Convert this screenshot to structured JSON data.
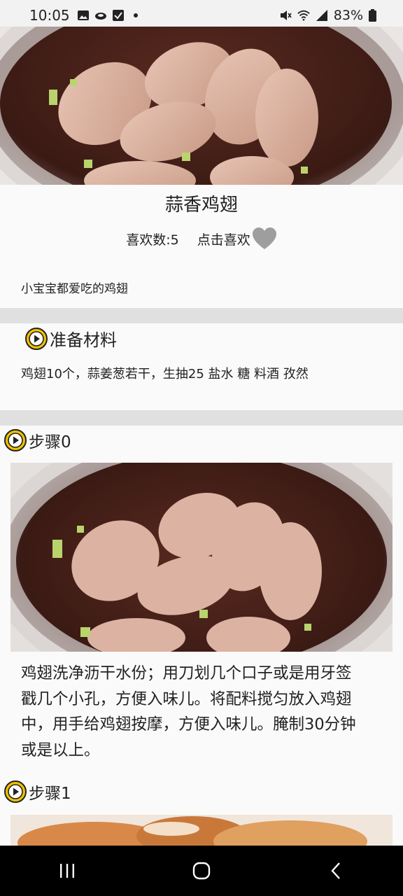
{
  "status_bar": {
    "time": "10:05",
    "battery": "83%",
    "icons": [
      "gallery-icon",
      "cloud-icon",
      "checkbox-icon",
      "dot-icon",
      "mute-icon",
      "wifi-icon",
      "signal-icon",
      "battery-icon"
    ]
  },
  "recipe": {
    "title": "蒜香鸡翅",
    "likes_label": "喜欢数:5",
    "like_action": "点击喜欢",
    "description": "小宝宝都爱吃的鸡翅"
  },
  "materials": {
    "heading": "准备材料",
    "text": "鸡翅10个，蒜姜葱若干，生抽25 盐水  糖  料酒 孜然"
  },
  "steps": [
    {
      "label": "步骤0",
      "text_lines": [
        "鸡翅洗净沥干水份；用刀划几个口子或是用牙签",
        "戳几个小孔，方便入味儿。将配料搅匀放入鸡翅",
        "中，用手给鸡翅按摩，方便入味儿。腌制30分钟",
        "或是以上。"
      ]
    },
    {
      "label": "步骤1"
    }
  ],
  "navbar": {
    "icons": [
      "recent-apps-icon",
      "home-icon",
      "back-icon"
    ]
  },
  "colors": {
    "accent_play": "#f2c200",
    "heart": "#9e9e9e",
    "divider": "#e0e0e0",
    "navbar": "#000000"
  }
}
